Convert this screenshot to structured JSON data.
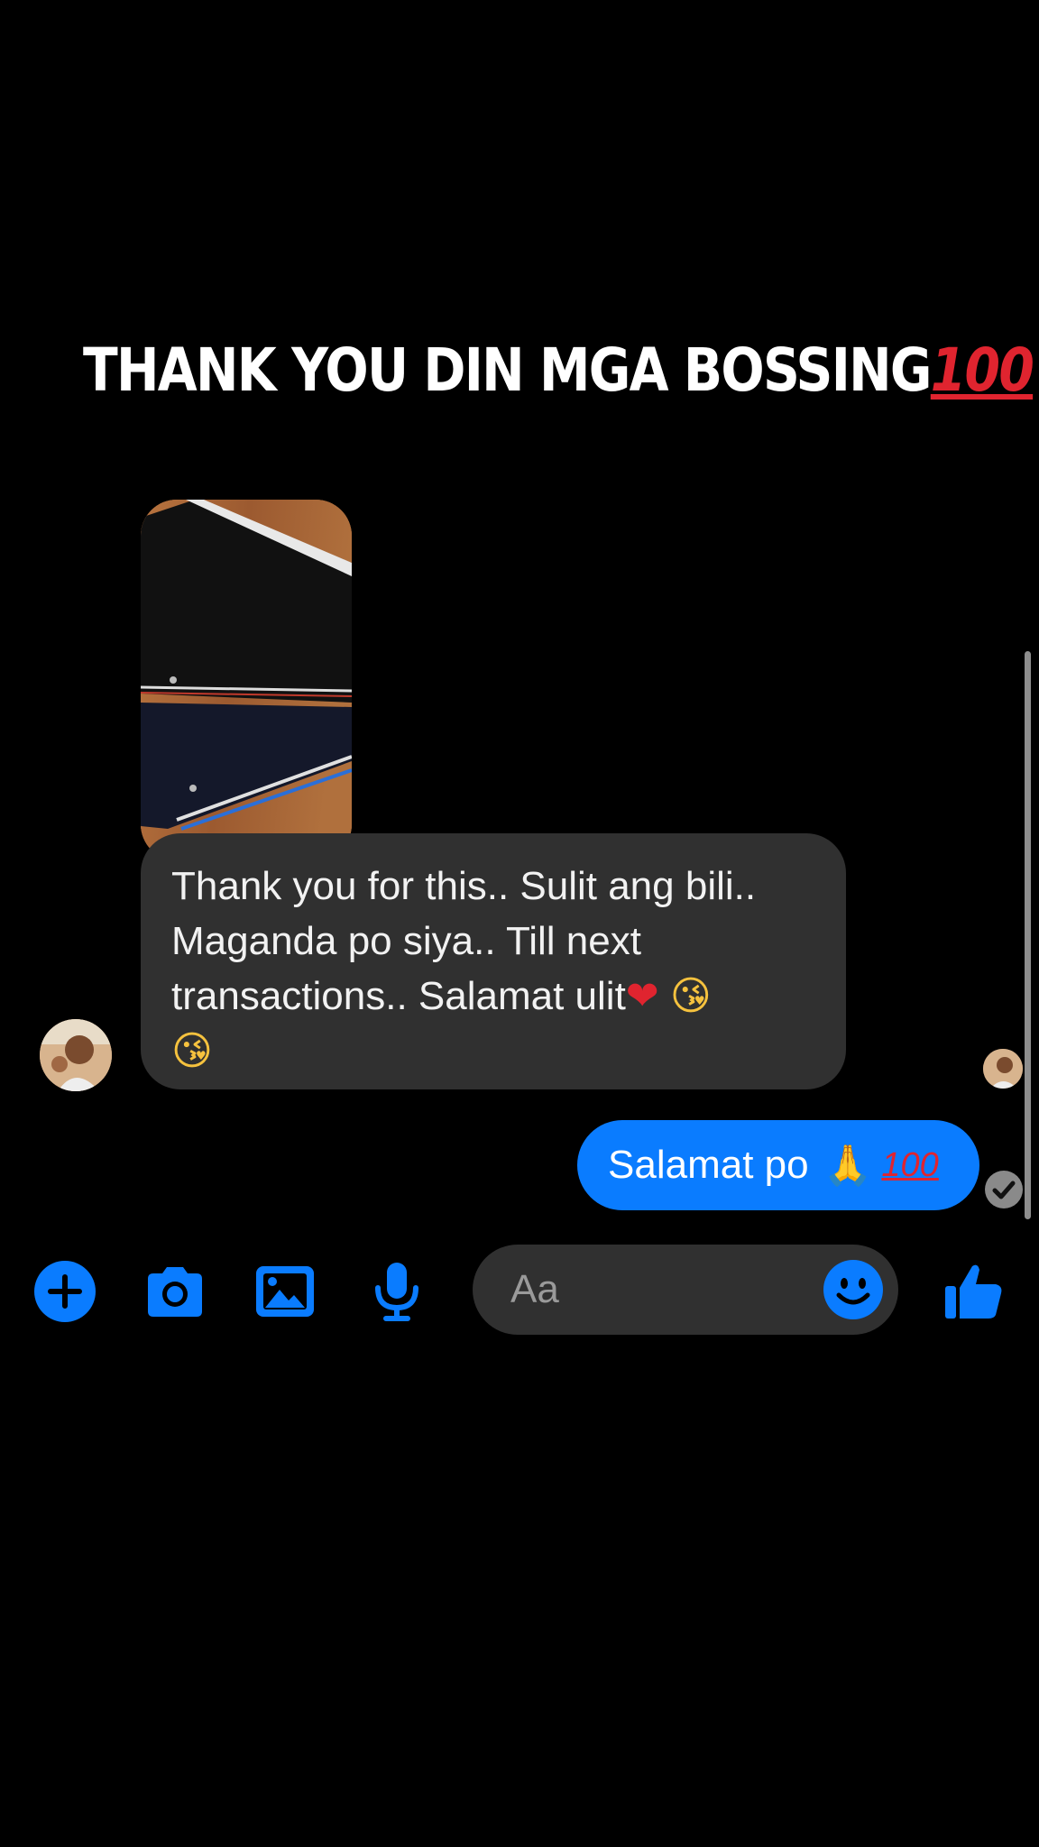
{
  "story": {
    "caption": "THANK YOU DIN MGA BOSSING",
    "caption_emoji": "💯"
  },
  "conversation": {
    "incoming": {
      "lines": [
        "Thank you for this.. Sulit ang bili..",
        "Maganda po siya.. Till next",
        "transactions.. Salamat ulit"
      ],
      "line3_emojis": [
        "❤",
        "😘"
      ],
      "line4_emoji": "😘"
    },
    "outgoing": {
      "text": "Salamat po",
      "emojis": [
        "🙏",
        "💯"
      ]
    }
  },
  "composer": {
    "placeholder": "Aa",
    "icons": [
      "plus-icon",
      "camera-icon",
      "gallery-icon",
      "microphone-icon",
      "smiley-icon",
      "thumbs-up-icon"
    ],
    "accent_color": "#0a7cff"
  },
  "colors": {
    "background": "#000000",
    "incoming_bubble": "#303030",
    "outgoing_bubble": "#0a7cff",
    "hundred_red": "#e0242f"
  }
}
